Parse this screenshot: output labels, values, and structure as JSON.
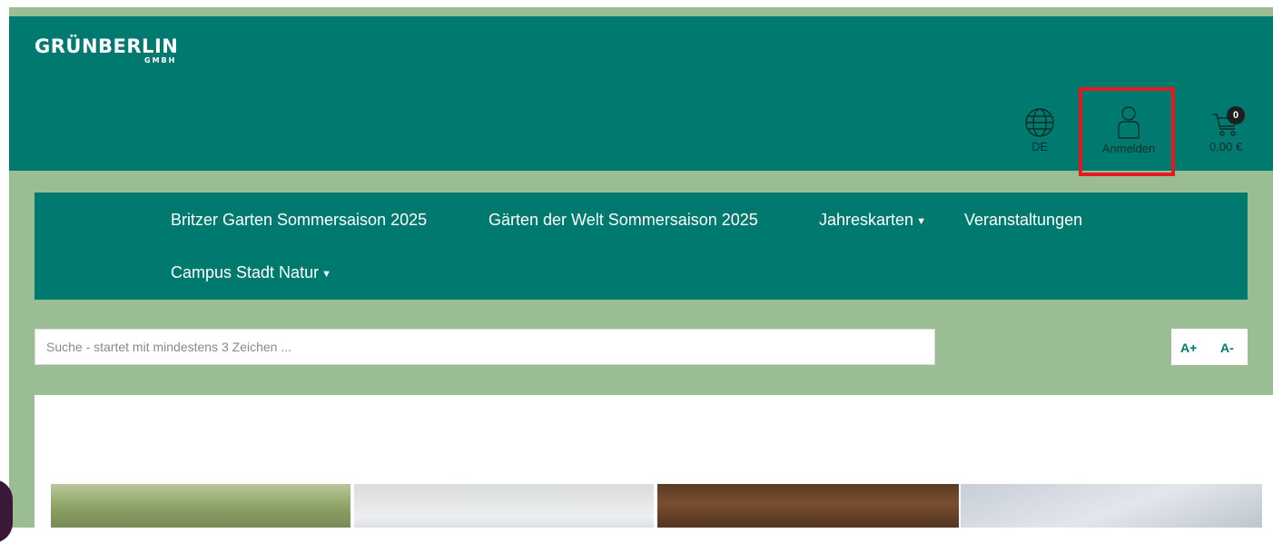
{
  "brand": {
    "name": "GRÜNBERLIN",
    "suffix": "GMBH"
  },
  "header": {
    "language": {
      "label": "DE",
      "icon": "globe-icon"
    },
    "login": {
      "label": "Anmelden",
      "icon": "user-icon"
    },
    "cart": {
      "count": "0",
      "total": "0,00 €",
      "icon": "cart-icon"
    }
  },
  "nav": {
    "items": [
      {
        "label": "Britzer Garten Sommersaison 2025"
      },
      {
        "label": "Gärten der Welt Sommersaison 2025"
      },
      {
        "label": "Jahreskarten",
        "dropdown": true
      },
      {
        "label": "Veranstaltungen"
      },
      {
        "label": "Campus Stadt Natur",
        "dropdown": true
      }
    ]
  },
  "search": {
    "placeholder": "Suche - startet mit mindestens 3 Zeichen ...",
    "value": ""
  },
  "font_size": {
    "increase": "A+",
    "decrease": "A-"
  },
  "colors": {
    "header": "#007a6e",
    "background": "#9abd93",
    "highlight": "#e3191f"
  }
}
